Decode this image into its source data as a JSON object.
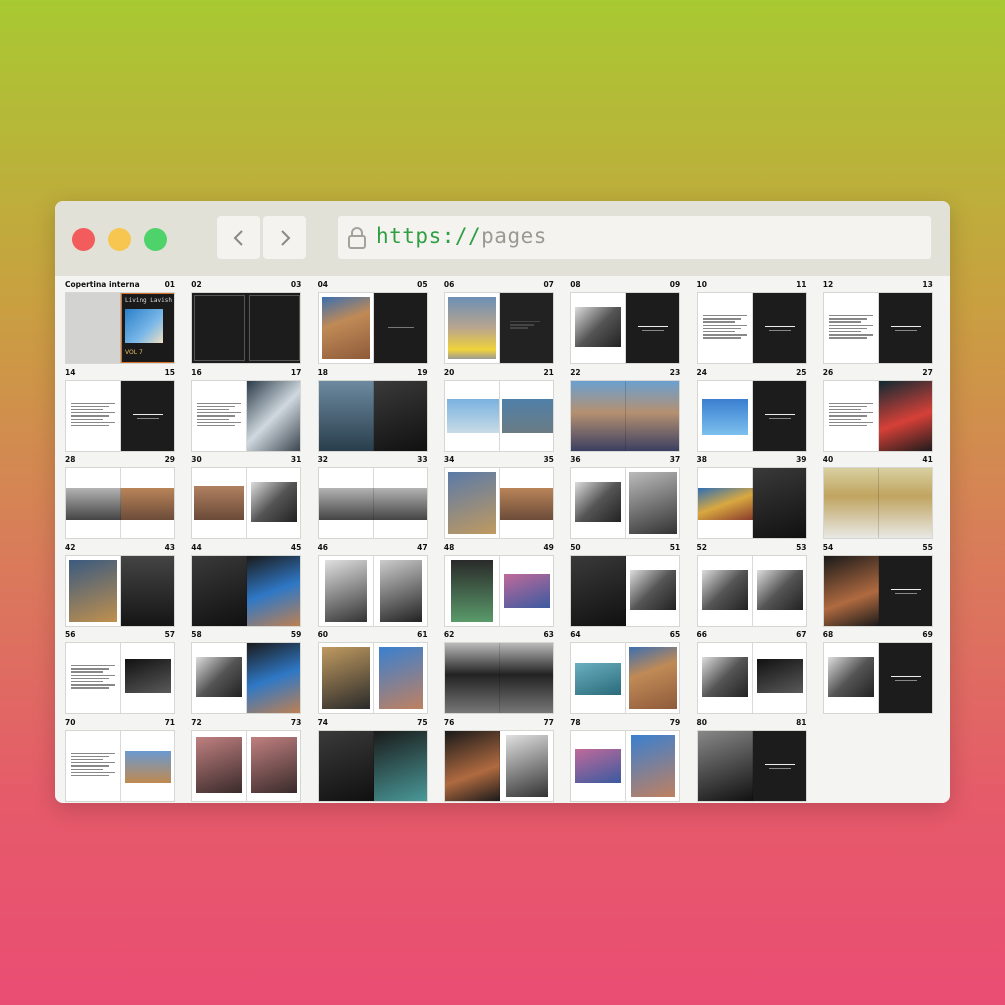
{
  "browser": {
    "url_protocol": "https://",
    "url_path": "pages",
    "controls": {
      "close": "#f25c5c",
      "minimize": "#f6c650",
      "maximize": "#4ed36b"
    }
  },
  "pages": [
    {
      "left": "Copertina interna",
      "right": "01",
      "l": "gray",
      "r": "cover"
    },
    {
      "left": "02",
      "right": "03",
      "l": "black-frame",
      "r": "black-frame"
    },
    {
      "left": "04",
      "right": "05",
      "l": "photo-warm",
      "r": "black-caption"
    },
    {
      "left": "06",
      "right": "07",
      "l": "photo-yellow",
      "r": "black-dim"
    },
    {
      "left": "08",
      "right": "09",
      "l": "photo-bw-inset",
      "r": "black-title"
    },
    {
      "left": "10",
      "right": "11",
      "l": "text",
      "r": "black-title"
    },
    {
      "left": "12",
      "right": "13",
      "l": "text",
      "r": "black-title"
    },
    {
      "left": "14",
      "right": "15",
      "l": "text",
      "r": "black-title"
    },
    {
      "left": "16",
      "right": "17",
      "l": "text",
      "r": "photo-window"
    },
    {
      "left": "18",
      "right": "19",
      "l": "photo-shadow",
      "r": "photo-dark"
    },
    {
      "left": "20",
      "right": "21",
      "l": "photo-sky-inset",
      "r": "photo-sea-inset"
    },
    {
      "left": "22",
      "right": "23",
      "l": "photo-crowd",
      "r": "photo-crowd"
    },
    {
      "left": "24",
      "right": "25",
      "l": "photo-blue-inset",
      "r": "black-title"
    },
    {
      "left": "26",
      "right": "27",
      "l": "text",
      "r": "photo-red"
    },
    {
      "left": "28",
      "right": "29",
      "l": "photo-bw-band",
      "r": "photo-warm-band"
    },
    {
      "left": "30",
      "right": "31",
      "l": "photo-warm-inset",
      "r": "photo-bw-inset"
    },
    {
      "left": "32",
      "right": "33",
      "l": "photo-bw-band",
      "r": "photo-bw-band"
    },
    {
      "left": "34",
      "right": "35",
      "l": "photo-portrait",
      "r": "photo-warm-band"
    },
    {
      "left": "36",
      "right": "37",
      "l": "photo-bw-inset",
      "r": "photo-bw-full"
    },
    {
      "left": "38",
      "right": "39",
      "l": "photo-color-band",
      "r": "photo-dark"
    },
    {
      "left": "40",
      "right": "41",
      "l": "photo-street",
      "r": "photo-street"
    },
    {
      "left": "42",
      "right": "43",
      "l": "photo-collage",
      "r": "photo-car"
    },
    {
      "left": "44",
      "right": "45",
      "l": "photo-dark",
      "r": "photo-blue-dark"
    },
    {
      "left": "46",
      "right": "47",
      "l": "photo-bw-tall",
      "r": "photo-bw-door"
    },
    {
      "left": "48",
      "right": "49",
      "l": "photo-green",
      "r": "photo-pink-inset"
    },
    {
      "left": "50",
      "right": "51",
      "l": "photo-dark",
      "r": "photo-bw-inset"
    },
    {
      "left": "52",
      "right": "53",
      "l": "photo-bw-inset",
      "r": "photo-bw-inset"
    },
    {
      "left": "54",
      "right": "55",
      "l": "photo-warm-dark",
      "r": "black-title"
    },
    {
      "left": "56",
      "right": "57",
      "l": "text",
      "r": "photo-dark-inset"
    },
    {
      "left": "58",
      "right": "59",
      "l": "photo-bw-inset",
      "r": "photo-blue-dark"
    },
    {
      "left": "60",
      "right": "61",
      "l": "photo-tree",
      "r": "photo-blue-tall"
    },
    {
      "left": "62",
      "right": "63",
      "l": "photo-road",
      "r": "photo-road"
    },
    {
      "left": "64",
      "right": "65",
      "l": "photo-teal-inset",
      "r": "photo-warm"
    },
    {
      "left": "66",
      "right": "67",
      "l": "photo-bw-inset",
      "r": "photo-dark-inset"
    },
    {
      "left": "68",
      "right": "69",
      "l": "photo-bw-inset",
      "r": "black-title"
    },
    {
      "left": "70",
      "right": "71",
      "l": "text",
      "r": "photo-field-inset"
    },
    {
      "left": "72",
      "right": "73",
      "l": "photo-pink-tall",
      "r": "photo-pink-tall"
    },
    {
      "left": "74",
      "right": "75",
      "l": "photo-dark",
      "r": "photo-teal-dark"
    },
    {
      "left": "76",
      "right": "77",
      "l": "photo-warm-dark",
      "r": "photo-bw-tall"
    },
    {
      "left": "78",
      "right": "79",
      "l": "photo-pink-inset",
      "r": "photo-blue-tall"
    },
    {
      "left": "80",
      "right": "81",
      "l": "photo-bw-collage",
      "r": "black-title"
    }
  ]
}
